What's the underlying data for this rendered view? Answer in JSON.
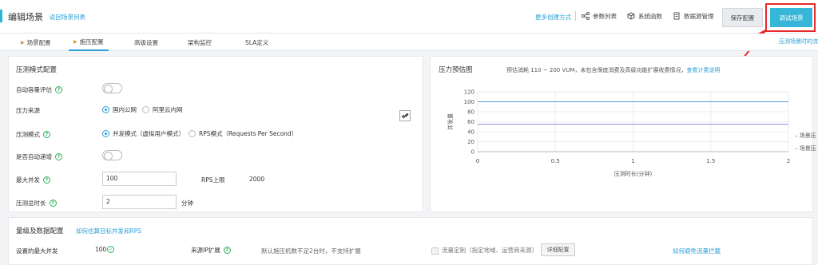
{
  "header": {
    "title": "编辑场景",
    "back_link": "返回场景列表",
    "more_link": "更多创建方式",
    "params_label": "参数列表",
    "functions_label": "系统函数",
    "datasource_label": "数据源管理",
    "save_label": "保存配置",
    "debug_label": "调试场景"
  },
  "tabs": {
    "items": [
      {
        "label": "场景配置"
      },
      {
        "label": "施压配置"
      },
      {
        "label": "高级设置"
      },
      {
        "label": "架构监控"
      },
      {
        "label": "SLA定义"
      }
    ],
    "active_index": 1,
    "right_link": "压测场景时的流"
  },
  "config": {
    "title": "压测模式配置",
    "auto_assess_label": "自动容量评估",
    "source_label": "压力来源",
    "source_options": [
      "国内公网",
      "阿里云内网"
    ],
    "source_selected": 0,
    "mode_label": "压测模式",
    "mode_options": [
      "并发模式（虚拟用户模式）",
      "RPS模式（Requests Per Second）"
    ],
    "mode_selected": 0,
    "auto_increment_label": "是否自动递增",
    "max_concurrency_label": "最大并发",
    "max_concurrency_value": "100",
    "rps_limit_label": "RPS上限",
    "rps_limit_value": "2000",
    "duration_label": "压测总时长",
    "duration_value": "2",
    "duration_unit": "分钟"
  },
  "estimate": {
    "title": "压力预估图",
    "note": "预估消耗 110 ~ 200 VUM，未包含保底消费及高级功能扩展收费情况，",
    "note_link": "查看计费说明",
    "legend": [
      "场景压",
      "场景压"
    ]
  },
  "chart_data": {
    "type": "line",
    "xlabel": "压测时长(分钟)",
    "ylabel": "并发量",
    "xlim": [
      0,
      2
    ],
    "ylim": [
      0,
      120
    ],
    "x_ticks": [
      "0",
      "0.5",
      "1",
      "1.5",
      "2"
    ],
    "y_ticks": [
      "0",
      "20",
      "40",
      "60",
      "80",
      "100",
      "120"
    ],
    "series": [
      {
        "x": [
          0,
          2
        ],
        "values": [
          100,
          100
        ],
        "color": "#5b9bd5"
      },
      {
        "x": [
          0,
          2
        ],
        "values": [
          55,
          55
        ],
        "color": "#8e8ed8"
      }
    ],
    "grid": true
  },
  "traffic": {
    "title": "量级及数据配置",
    "title_link": "如何估算目标并发和RPS",
    "max_set_label": "设置的最大并发",
    "max_set_value": "100",
    "ip_label": "来源IP扩展",
    "ip_note": "默认施压机数不足2台时，不支持扩展",
    "flow_label": "流量定制（指定地域、运营商来源）",
    "flow_button": "详细配置",
    "avoid_link": "如何避免流量拦截"
  },
  "colors": {
    "accent": "#36b6d8",
    "link": "#2a9fd6",
    "highlight": "#e62a2a"
  }
}
